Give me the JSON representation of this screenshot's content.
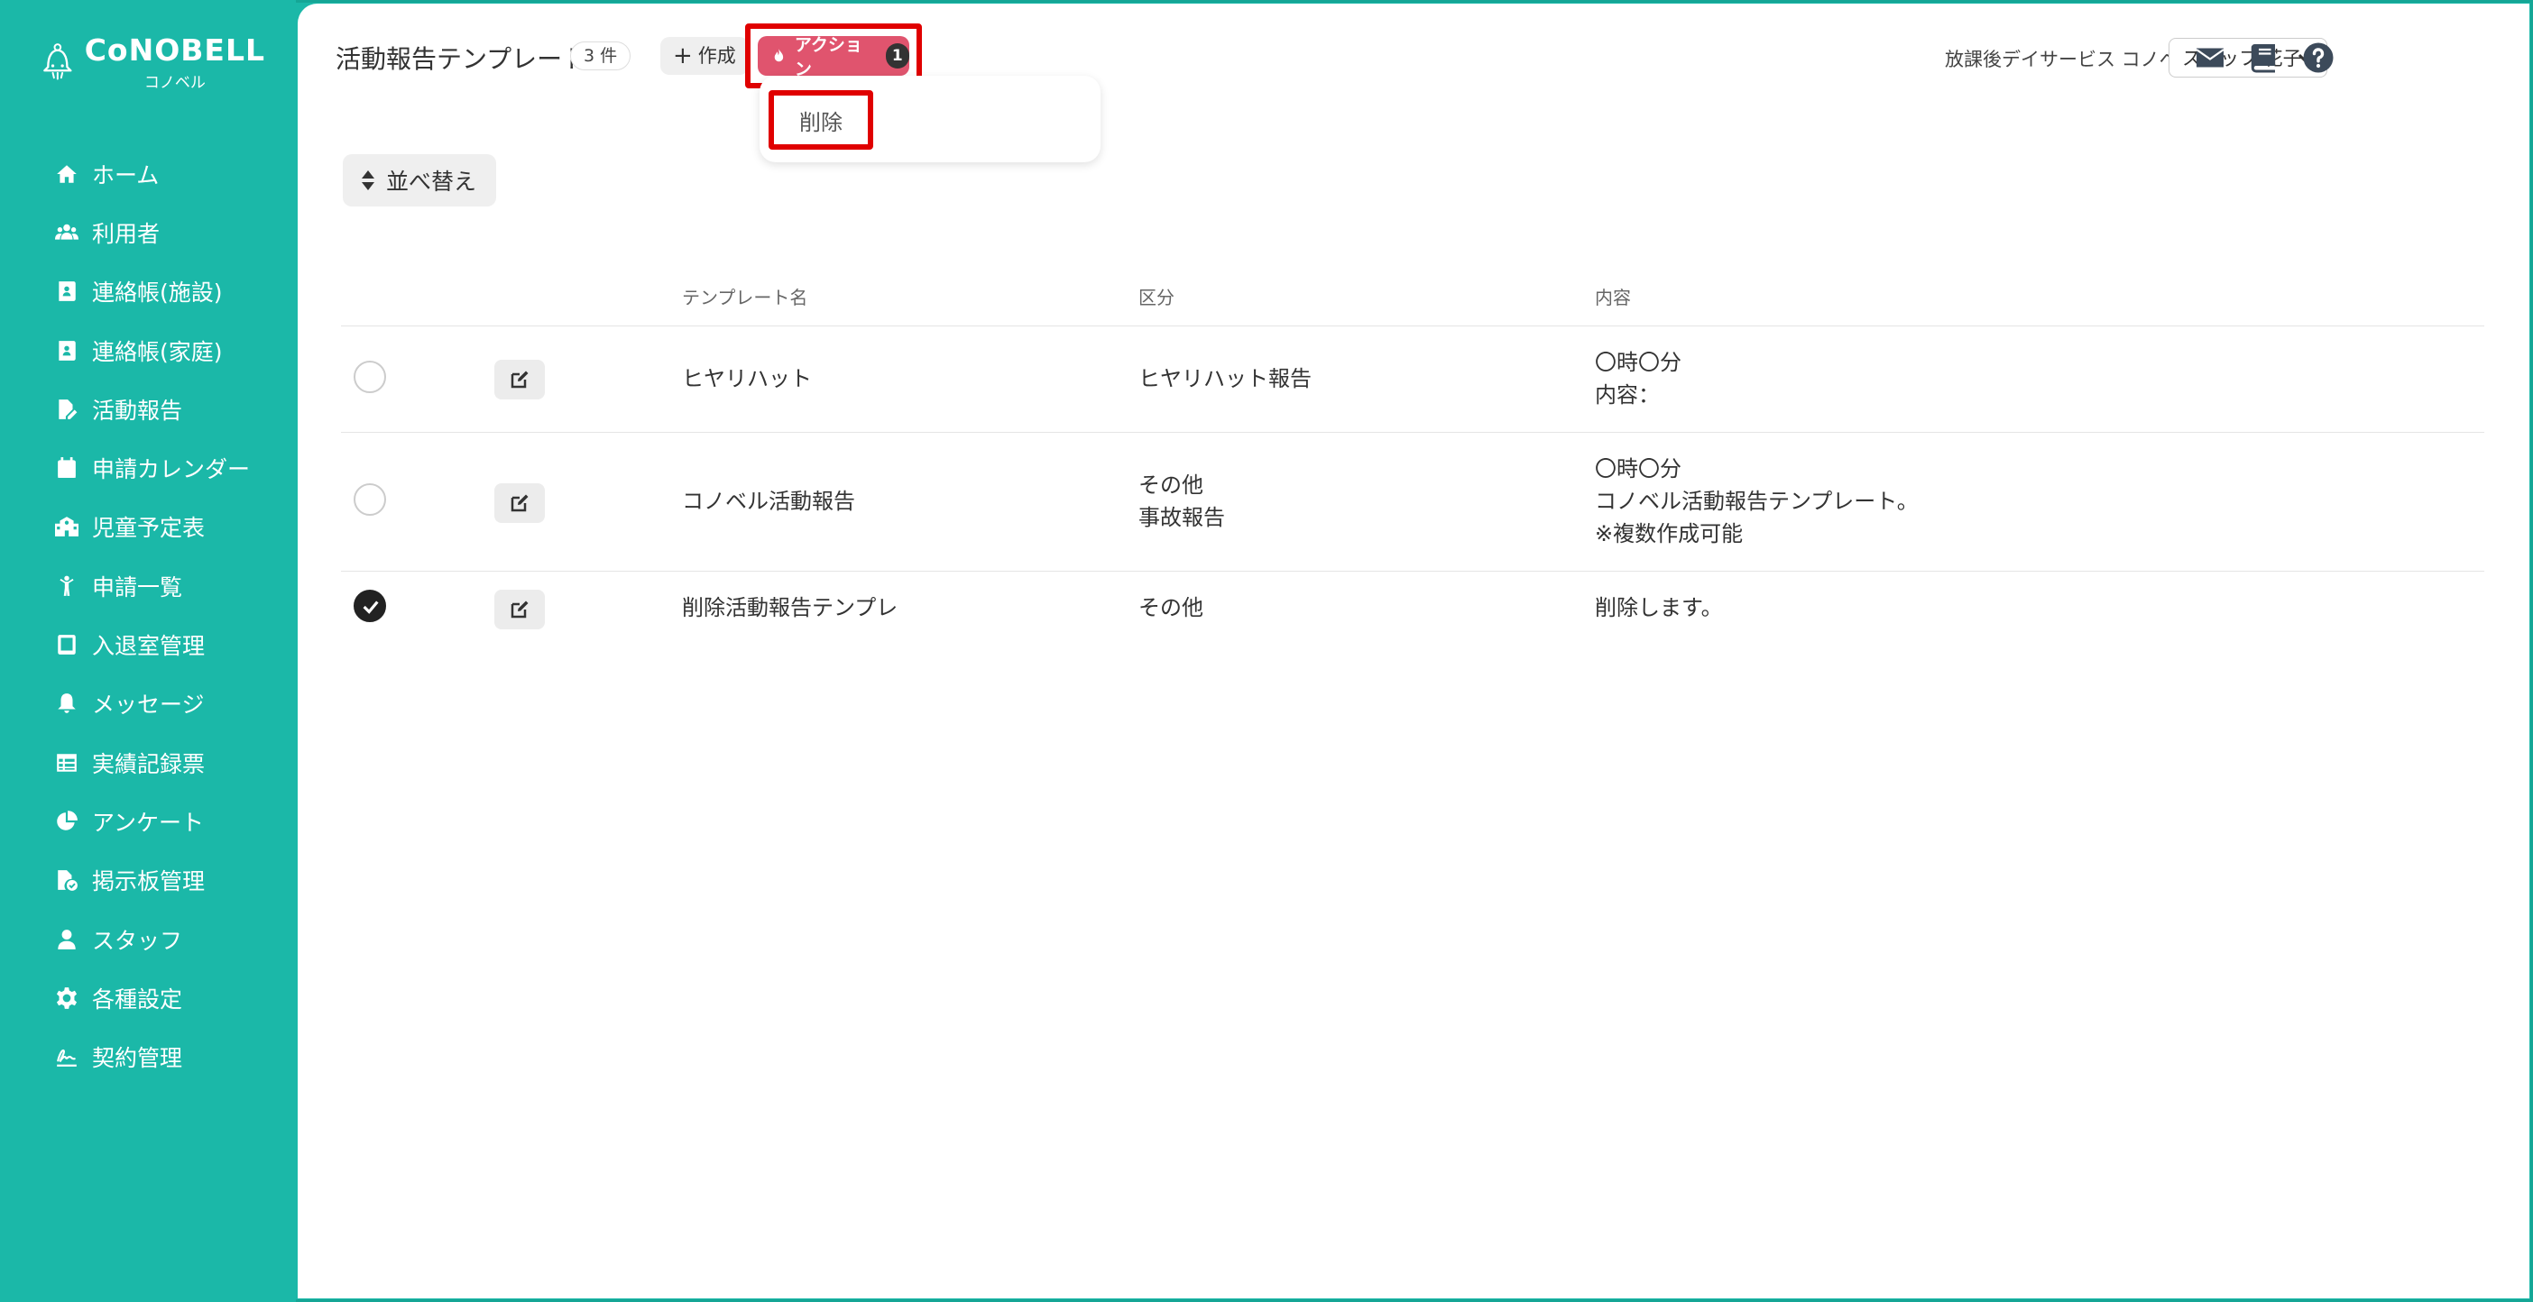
{
  "app": {
    "logo_text": "CoNOBELL",
    "logo_sub": "コノベル"
  },
  "sidebar": {
    "items": [
      {
        "label": "ホーム",
        "icon": "home-icon"
      },
      {
        "label": "利用者",
        "icon": "users-icon"
      },
      {
        "label": "連絡帳(施設)",
        "icon": "contact-book-icon"
      },
      {
        "label": "連絡帳(家庭)",
        "icon": "contact-book-icon"
      },
      {
        "label": "活動報告",
        "icon": "file-edit-icon"
      },
      {
        "label": "申請カレンダー",
        "icon": "calendar-icon"
      },
      {
        "label": "児童予定表",
        "icon": "school-icon"
      },
      {
        "label": "申請一覧",
        "icon": "child-icon"
      },
      {
        "label": "入退室管理",
        "icon": "tablet-icon"
      },
      {
        "label": "メッセージ",
        "icon": "bell-icon"
      },
      {
        "label": "実績記録票",
        "icon": "table-icon"
      },
      {
        "label": "アンケート",
        "icon": "pie-chart-icon"
      },
      {
        "label": "掲示板管理",
        "icon": "file-check-icon"
      },
      {
        "label": "スタッフ",
        "icon": "staff-icon"
      },
      {
        "label": "各種設定",
        "icon": "gear-icon"
      },
      {
        "label": "契約管理",
        "icon": "signature-icon"
      }
    ]
  },
  "header": {
    "title": "活動報告テンプレート",
    "count": "3 件",
    "create_label": "作成",
    "action_label": "アクション",
    "action_count": "1",
    "dropdown_item": "削除",
    "facility": "放課後デイサービス コノベル",
    "staff_name": "スタッフ 花子"
  },
  "toolbar": {
    "sort_label": "並べ替え"
  },
  "table": {
    "headers": {
      "name": "テンプレート名",
      "category": "区分",
      "content": "内容"
    },
    "rows": [
      {
        "checked": false,
        "name": "ヒヤリハット",
        "category": [
          "ヒヤリハット報告"
        ],
        "content": [
          "〇時〇分",
          "内容："
        ]
      },
      {
        "checked": false,
        "name": "コノベル活動報告",
        "category": [
          "その他",
          "事故報告"
        ],
        "content": [
          "〇時〇分",
          "コノベル活動報告テンプレート。",
          "※複数作成可能"
        ]
      },
      {
        "checked": true,
        "name": "削除活動報告テンプレ",
        "category": [
          "その他"
        ],
        "content": [
          "削除します。"
        ]
      }
    ]
  },
  "colors": {
    "brand": "#1bb8a8",
    "action": "#e0546e",
    "highlight": "#e00000"
  }
}
